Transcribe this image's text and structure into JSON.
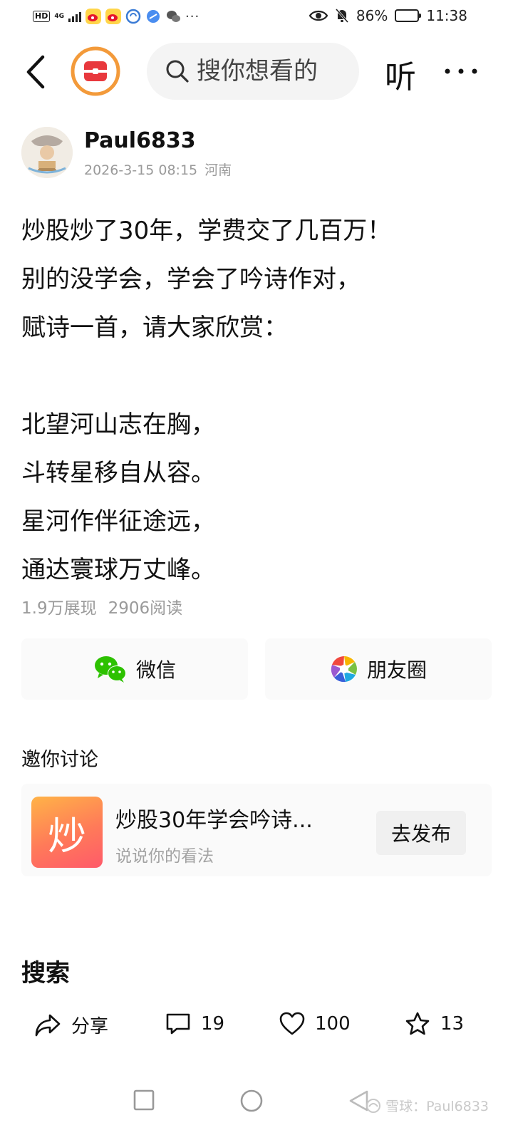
{
  "status_bar": {
    "hd": "HD",
    "network": "4G",
    "battery_percent": "86%",
    "battery_level": 0.86,
    "time": "11:38"
  },
  "top_nav": {
    "search_placeholder": "搜你想看的",
    "listen_label": "听"
  },
  "author": {
    "name": "Paul6833",
    "datetime": "2026-3-15 08:15",
    "location": "河南"
  },
  "post": {
    "lines": [
      "炒股炒了30年，学费交了几百万！",
      "别的没学会，学会了吟诗作对，",
      "赋诗一首，请大家欣赏：",
      "",
      "北望河山志在胸，",
      "斗转星移自从容。",
      "星河作伴征途远，",
      "通达寰球万丈峰。"
    ],
    "impressions": "1.9万展现",
    "reads": "2906阅读"
  },
  "share": {
    "wechat": "微信",
    "moments": "朋友圈"
  },
  "discussion": {
    "title": "邀你讨论",
    "icon_char": "炒",
    "topic": "炒股30年学会吟诗...",
    "subtitle": "说说你的看法",
    "button": "去发布"
  },
  "search_section": {
    "title": "搜索"
  },
  "actions": {
    "share_label": "分享",
    "comments": "19",
    "likes": "100",
    "favorites": "13"
  },
  "watermark": "雪球：Paul6833",
  "colors": {
    "wechat_green": "#2dc100",
    "logo_red": "#e8383d",
    "logo_ring": "#f39a3a",
    "topic_orange": "#ff7a59"
  }
}
